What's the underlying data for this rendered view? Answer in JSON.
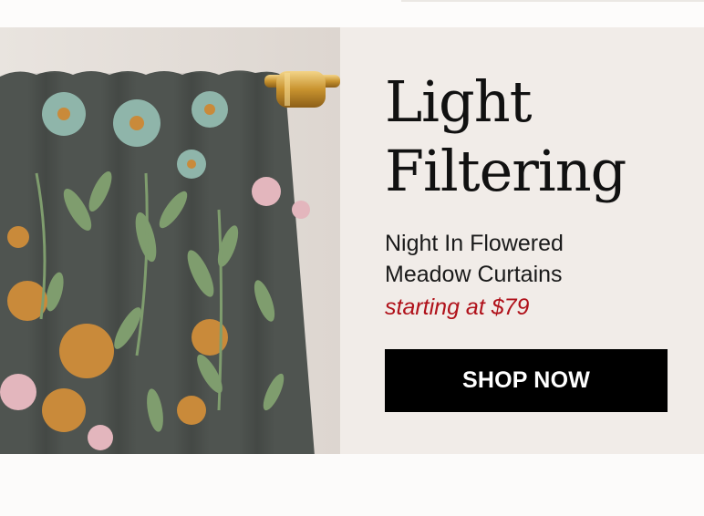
{
  "banner": {
    "headline_line1": "Light",
    "headline_line2": "Filtering",
    "product_line1": "Night In Flowered",
    "product_line2": "Meadow Curtains",
    "price_text": "starting at $79",
    "cta_label": "SHOP NOW",
    "image_subject": "floral-curtain-on-brass-rod"
  },
  "colors": {
    "background": "#f1ece8",
    "headline": "#111111",
    "price": "#b0111a",
    "button_bg": "#000000",
    "button_text": "#ffffff",
    "curtain_base": "#4f5450",
    "rod_brass": "#c89a3a"
  }
}
